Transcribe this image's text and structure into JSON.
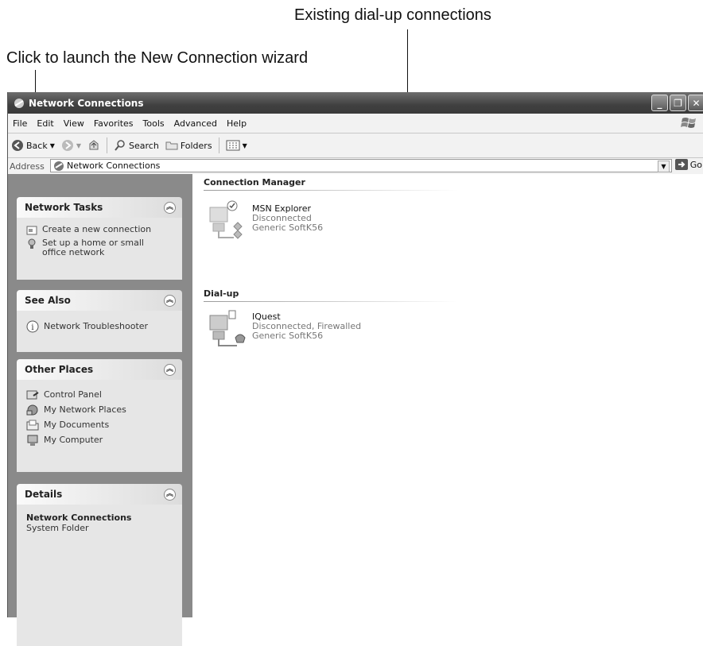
{
  "callouts": {
    "new_connection": "Click to launch the New Connection wizard",
    "existing_dialup": "Existing dial-up connections"
  },
  "window": {
    "title": "Network Connections",
    "controls": [
      "minimize-button",
      "maximize-button",
      "close-button"
    ]
  },
  "menu": {
    "items": [
      "File",
      "Edit",
      "View",
      "Favorites",
      "Tools",
      "Advanced",
      "Help"
    ]
  },
  "toolbar": {
    "back_label": "Back",
    "search_label": "Search",
    "folders_label": "Folders"
  },
  "address": {
    "label": "Address",
    "value": "Network Connections",
    "go_label": "Go"
  },
  "sidebar": {
    "network_tasks": {
      "title": "Network Tasks",
      "items": [
        {
          "label": "Create a new connection",
          "icon": "new-connection-icon"
        },
        {
          "label": "Set up a home or small office network",
          "icon": "home-network-icon"
        }
      ]
    },
    "see_also": {
      "title": "See Also",
      "items": [
        {
          "label": "Network Troubleshooter",
          "icon": "info-icon"
        }
      ]
    },
    "other_places": {
      "title": "Other Places",
      "items": [
        {
          "label": "Control Panel",
          "icon": "control-panel-icon"
        },
        {
          "label": "My Network Places",
          "icon": "network-places-icon"
        },
        {
          "label": "My Documents",
          "icon": "documents-folder-icon"
        },
        {
          "label": "My Computer",
          "icon": "computer-icon"
        }
      ]
    },
    "details": {
      "title": "Details",
      "name": "Network Connections",
      "type": "System Folder"
    }
  },
  "content": {
    "groups": [
      {
        "title": "Connection Manager",
        "connections": [
          {
            "name": "MSN Explorer",
            "status": "Disconnected",
            "device": "Generic SoftK56"
          }
        ]
      },
      {
        "title": "Dial-up",
        "connections": [
          {
            "name": "IQuest",
            "status": "Disconnected, Firewalled",
            "device": "Generic SoftK56"
          }
        ]
      }
    ]
  },
  "colors": {
    "titlebar": "#4a4a4a",
    "sidebar": "#8a8a8a",
    "panel_body": "#e6e6e6"
  }
}
